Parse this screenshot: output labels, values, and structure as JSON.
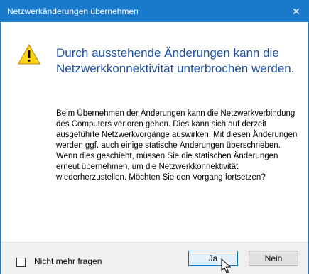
{
  "window": {
    "title": "Netzwerkänderungen übernehmen",
    "close_glyph": "✕"
  },
  "message": {
    "icon": "warning-icon",
    "heading": "Durch ausstehende Änderungen kann die Netzwerkkonnektivität unterbrochen werden.",
    "body": "Beim Übernehmen der Änderungen kann die Netzwerkverbindung des Computers verloren gehen. Dies kann sich auf derzeit ausgeführte Netzwerkvorgänge auswirken. Mit diesen Änderungen werden ggf. auch einige statische Änderungen überschrieben. Wenn dies geschieht, müssen Sie die statischen Änderungen erneut übernehmen, um die Netzwerkkonnektivität wiederherzustellen. Möchten Sie den Vorgang fortsetzen?"
  },
  "footer": {
    "checkbox_label": "Nicht mehr fragen",
    "checkbox_checked": false,
    "yes_label": "Ja",
    "no_label": "Nein"
  },
  "colors": {
    "titlebar": "#1979ca",
    "heading_text": "#1d4fa0",
    "footer_bg": "#f0f0f0",
    "warning_fill": "#fcd116"
  }
}
